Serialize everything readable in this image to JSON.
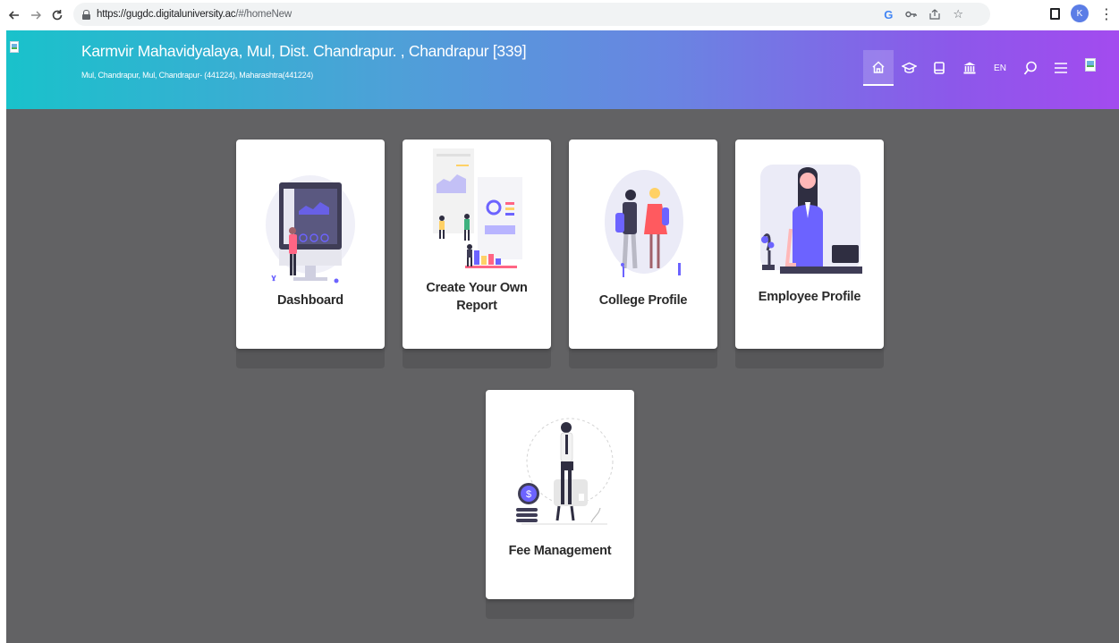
{
  "browser": {
    "back_icon": "arrow-left-icon",
    "forward_icon": "arrow-right-icon",
    "reload_icon": "reload-icon",
    "url_host": "https://gugdc.digitaluniversity.ac",
    "url_path": "/#/homeNew",
    "profile_initial": "K"
  },
  "header": {
    "college_name": "Karmvir Mahavidyalaya, Mul, Dist. Chandrapur. , Chandrapur [339]",
    "address": "Mul, Chandrapur, Mul, Chandrapur- (441224), Maharashtra(441224)",
    "icons": [
      "home-icon",
      "graduation-cap-icon",
      "book-icon",
      "bank-icon",
      "language-icon",
      "search-icon",
      "menu-icon",
      "user-avatar"
    ],
    "language": "EN",
    "gradient_start": "#19c2cb",
    "gradient_end": "#a34bef"
  },
  "cards": [
    {
      "label": "Dashboard",
      "illustration": "dashboard-illustration"
    },
    {
      "label": "Create Your Own Report",
      "line1": "Create Your Own",
      "line2": "Report",
      "illustration": "report-illustration"
    },
    {
      "label": "College Profile",
      "illustration": "college-profile-illustration"
    },
    {
      "label": "Employee Profile",
      "illustration": "employee-profile-illustration"
    },
    {
      "label": "Fee Management",
      "illustration": "fee-management-illustration"
    }
  ],
  "colors": {
    "page_background": "#626264",
    "card_background": "#ffffff",
    "accent_purple": "#6c63ff"
  }
}
